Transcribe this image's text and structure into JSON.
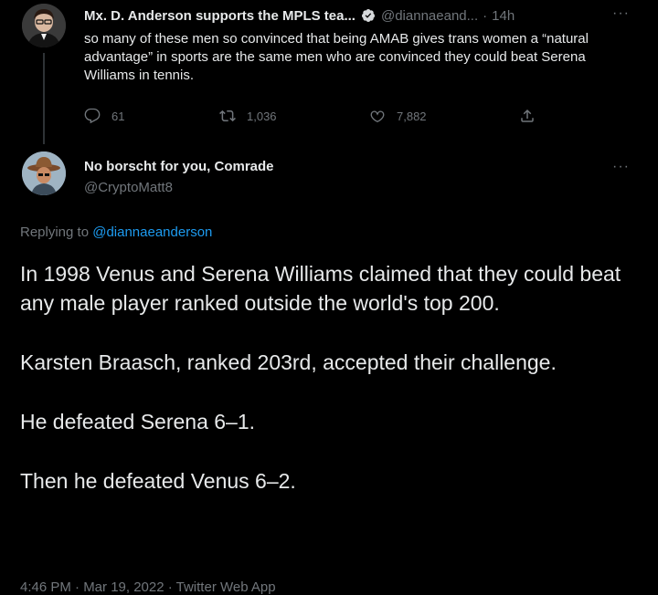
{
  "parent_tweet": {
    "display_name": "Mx. D. Anderson supports the MPLS tea...",
    "handle": "@diannaeand...",
    "separator": "·",
    "time": "14h",
    "more": "···",
    "text": "so many of these men so convinced that being AMAB gives trans women a “natural advantage” in sports are the same men who are convinced they could beat Serena Williams in tennis.",
    "replies": "61",
    "retweets": "1,036",
    "likes": "7,882",
    "icons": {
      "verified": "verified-badge-icon",
      "reply": "reply-icon",
      "retweet": "retweet-icon",
      "like": "heart-icon",
      "share": "share-icon"
    }
  },
  "reply_tweet": {
    "display_name": "No borscht for you, Comrade",
    "handle": "@CryptoMatt8",
    "more": "···",
    "replying_prefix": "Replying to ",
    "replying_to": "@diannaeanderson",
    "paragraphs": [
      "In 1998 Venus and Serena Williams claimed that they could beat any male player ranked outside the world's top 200.",
      "Karsten Braasch, ranked 203rd, accepted their challenge.",
      "He defeated Serena 6–1.",
      "Then he defeated Venus 6–2."
    ],
    "timestamp": "4:46 PM · Mar 19, 2022 · Twitter Web App"
  },
  "colors": {
    "background": "#000000",
    "text_primary": "#e7e9ea",
    "text_secondary": "#71767b",
    "accent": "#1d9bf0",
    "divider": "#2f3336"
  }
}
